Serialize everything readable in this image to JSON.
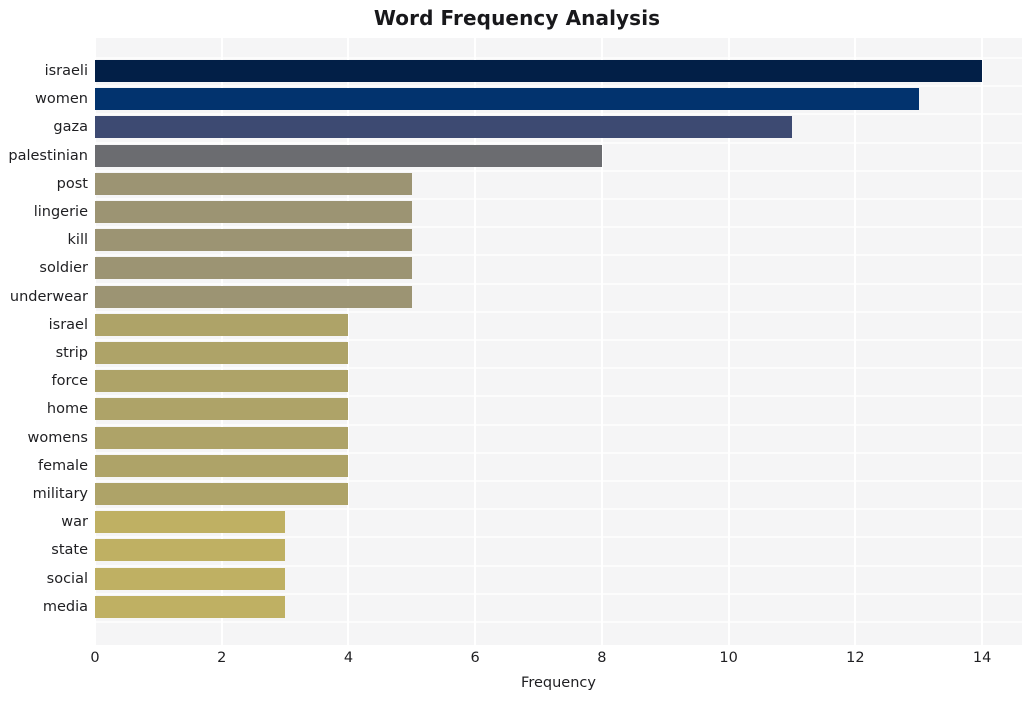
{
  "chart_data": {
    "type": "bar",
    "orientation": "horizontal",
    "title": "Word Frequency Analysis",
    "xlabel": "Frequency",
    "ylabel": "",
    "categories": [
      "israeli",
      "women",
      "gaza",
      "palestinian",
      "post",
      "lingerie",
      "kill",
      "soldier",
      "underwear",
      "israel",
      "strip",
      "force",
      "home",
      "womens",
      "female",
      "military",
      "war",
      "state",
      "social",
      "media"
    ],
    "values": [
      14,
      13,
      11,
      8,
      5,
      5,
      5,
      5,
      5,
      4,
      4,
      4,
      4,
      4,
      4,
      4,
      3,
      3,
      3,
      3
    ],
    "bar_colors": [
      "#021f47",
      "#02336e",
      "#3d4a72",
      "#6b6c70",
      "#9c9473",
      "#9c9473",
      "#9c9473",
      "#9c9473",
      "#9c9473",
      "#aea368",
      "#aea368",
      "#aea368",
      "#aea368",
      "#aea368",
      "#aea368",
      "#aea368",
      "#bfb063",
      "#bfb063",
      "#bfb063",
      "#bfb063"
    ],
    "xticks": [
      0,
      2,
      4,
      6,
      8,
      10,
      12,
      14
    ],
    "xtick_labels": [
      "0",
      "2",
      "4",
      "6",
      "8",
      "10",
      "12",
      "14"
    ],
    "xlim": [
      0,
      14.63
    ],
    "grid": true,
    "grid_color": "#ffffff",
    "plot_background": "#f5f5f6",
    "figure_background": "#ffffff",
    "legend": null
  }
}
